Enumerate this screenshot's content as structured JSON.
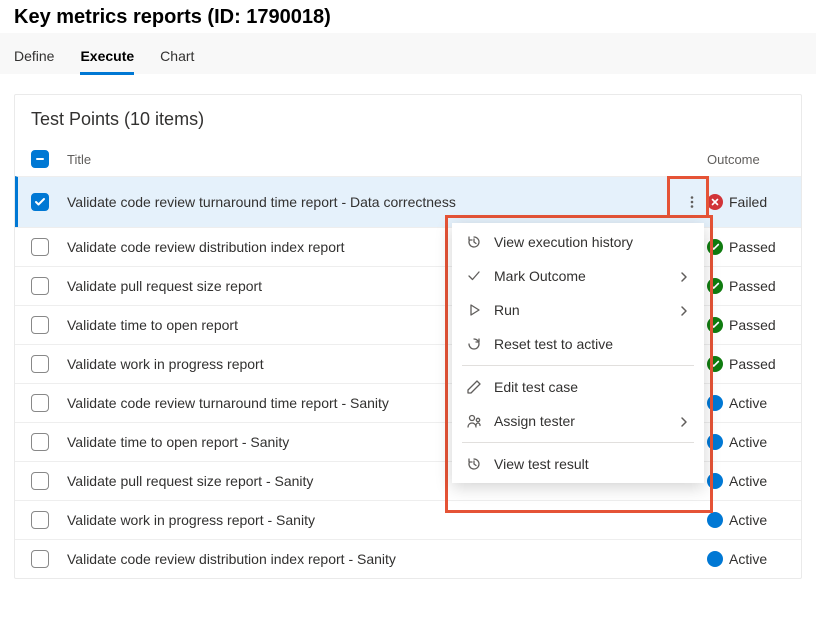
{
  "page": {
    "title": "Key metrics reports (ID: 1790018)"
  },
  "tabs": [
    {
      "label": "Define",
      "active": false
    },
    {
      "label": "Execute",
      "active": true
    },
    {
      "label": "Chart",
      "active": false
    }
  ],
  "panel": {
    "title": "Test Points (10 items)"
  },
  "columns": {
    "title": "Title",
    "outcome": "Outcome"
  },
  "outcomes": {
    "failed": "Failed",
    "passed": "Passed",
    "active": "Active"
  },
  "rows": [
    {
      "title": "Validate code review turnaround time report - Data correctness",
      "outcome": "failed",
      "selected": true,
      "showMenuButton": true
    },
    {
      "title": "Validate code review distribution index report",
      "outcome": "passed",
      "selected": false
    },
    {
      "title": "Validate pull request size report",
      "outcome": "passed",
      "selected": false
    },
    {
      "title": "Validate time to open report",
      "outcome": "passed",
      "selected": false
    },
    {
      "title": "Validate work in progress report",
      "outcome": "passed",
      "selected": false
    },
    {
      "title": "Validate code review turnaround time report - Sanity",
      "outcome": "active",
      "selected": false
    },
    {
      "title": "Validate time to open report - Sanity",
      "outcome": "active",
      "selected": false
    },
    {
      "title": "Validate pull request size report - Sanity",
      "outcome": "active",
      "selected": false
    },
    {
      "title": "Validate work in progress report - Sanity",
      "outcome": "active",
      "selected": false
    },
    {
      "title": "Validate code review distribution index report - Sanity",
      "outcome": "active",
      "selected": false
    }
  ],
  "menu": {
    "groups": [
      [
        {
          "icon": "history",
          "label": "View execution history",
          "submenu": false
        },
        {
          "icon": "check",
          "label": "Mark Outcome",
          "submenu": true
        },
        {
          "icon": "play",
          "label": "Run",
          "submenu": true
        },
        {
          "icon": "reset",
          "label": "Reset test to active",
          "submenu": false
        }
      ],
      [
        {
          "icon": "edit",
          "label": "Edit test case",
          "submenu": false
        },
        {
          "icon": "assign",
          "label": "Assign tester",
          "submenu": true
        }
      ],
      [
        {
          "icon": "history",
          "label": "View test result",
          "submenu": false
        }
      ]
    ]
  }
}
